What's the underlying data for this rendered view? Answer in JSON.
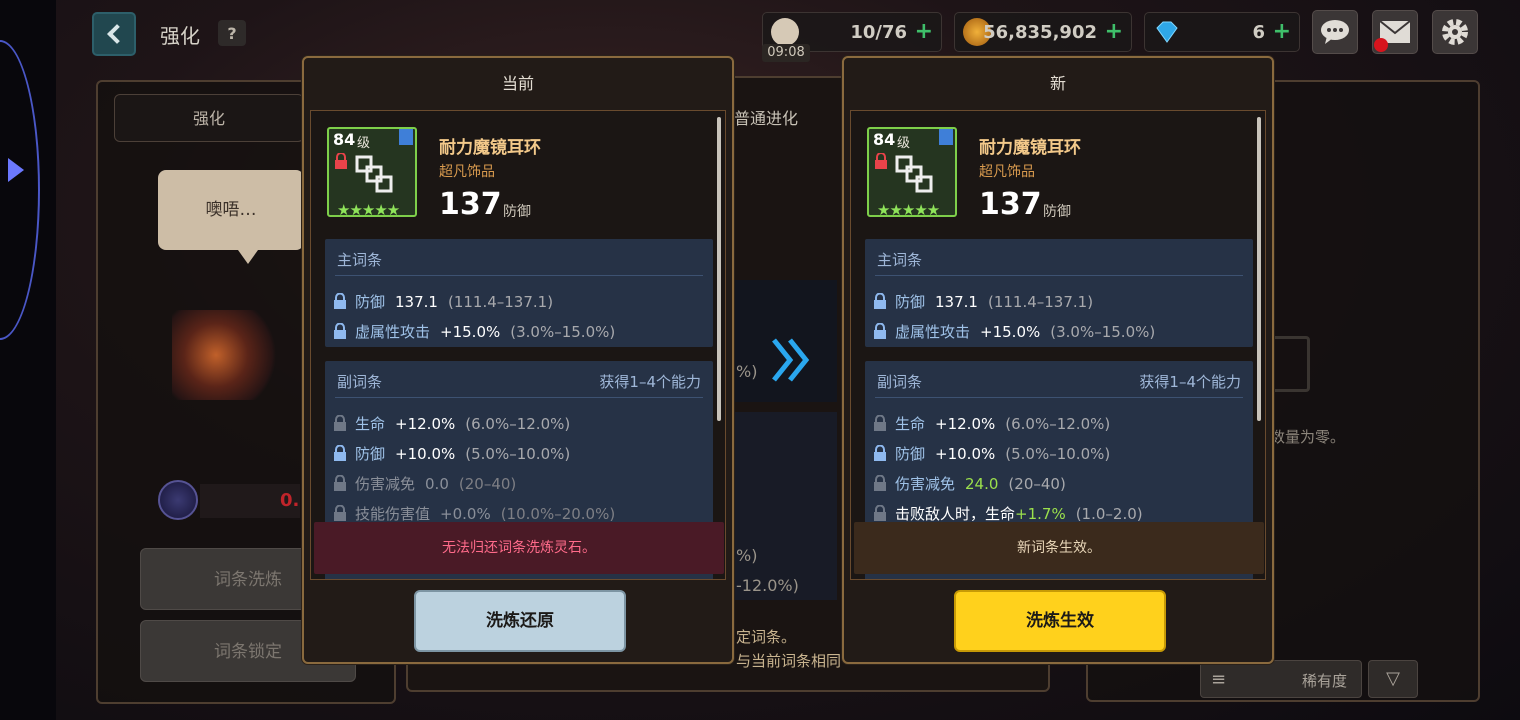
{
  "topbar": {
    "title": "强化",
    "help_label": "?",
    "stamina": "10/76",
    "stamina_timer": "09:08",
    "gold": "56,835,902",
    "gems": "6",
    "plus": "+"
  },
  "background": {
    "tab_left": "强化",
    "tab_mid": "普通进化",
    "speech": "噢唔…",
    "counter_fragment": "0.",
    "btn_reroll": "词条洗炼",
    "btn_lock": "词条锁定",
    "mid_fragment_1": "%)",
    "mid_fragment_2": "%)",
    "mid_fragment_3": "-12.0%)",
    "mid_fragment_4": "定词条。",
    "mid_fragment_5": "与当前词条相同",
    "right_zero_text": "数量为零。",
    "sort_menu": "≡",
    "sort_label": "稀有度",
    "sort_toggle": "▽"
  },
  "current": {
    "header": "当前",
    "level": "84",
    "level_unit": "级",
    "stars": "★★★★★",
    "name": "耐力魔镜耳环",
    "rarity": "超凡饰品",
    "stat_value": "137",
    "stat_name": "防御",
    "main_title": "主词条",
    "main": [
      {
        "name": "防御",
        "value": "137.1",
        "range": "(111.4–137.1)"
      },
      {
        "name": "虚属性攻击",
        "value": "+15.0%",
        "range": "(3.0%–15.0%)"
      }
    ],
    "sub_title": "副词条",
    "sub_hint": "获得1–4个能力",
    "sub": [
      {
        "name": "生命",
        "value": "+12.0%",
        "range": "(6.0%–12.0%)"
      },
      {
        "name": "防御",
        "value": "+10.0%",
        "range": "(5.0%–10.0%)"
      },
      {
        "name": "伤害减免",
        "value": "0.0",
        "range": "(20–40)"
      },
      {
        "name": "技能伤害值",
        "value": "+0.0%",
        "range": "(10.0%–20.0%)"
      }
    ],
    "message": "无法归还词条洗炼灵石。",
    "button": "洗炼还原"
  },
  "new": {
    "header": "新",
    "level": "84",
    "level_unit": "级",
    "stars": "★★★★★",
    "name": "耐力魔镜耳环",
    "rarity": "超凡饰品",
    "stat_value": "137",
    "stat_name": "防御",
    "main_title": "主词条",
    "main": [
      {
        "name": "防御",
        "value": "137.1",
        "range": "(111.4–137.1)"
      },
      {
        "name": "虚属性攻击",
        "value": "+15.0%",
        "range": "(3.0%–15.0%)"
      }
    ],
    "sub_title": "副词条",
    "sub_hint": "获得1–4个能力",
    "sub": [
      {
        "name": "生命",
        "value": "+12.0%",
        "range": "(6.0%–12.0%)"
      },
      {
        "name": "防御",
        "value": "+10.0%",
        "range": "(5.0%–10.0%)"
      },
      {
        "name": "伤害减免",
        "value": "24.0",
        "range": "(20–40)"
      },
      {
        "name_prefix": "击败敌人时，生命",
        "value": "+1.7%",
        "range": "(1.0–2.0)"
      }
    ],
    "message": "新词条生效。",
    "button": "洗炼生效"
  },
  "colors": {
    "panel_border": "#8a6a3e",
    "attr_bg": "#263246",
    "attr_name": "#9fc2e8",
    "green_value": "#9be04c",
    "restore_button": "#bcd2df",
    "apply_button": "#ffd11c",
    "warn_bg": "#4a1a26",
    "warn_text": "#ff6b8a",
    "ok_bg": "#3b2a1c"
  }
}
